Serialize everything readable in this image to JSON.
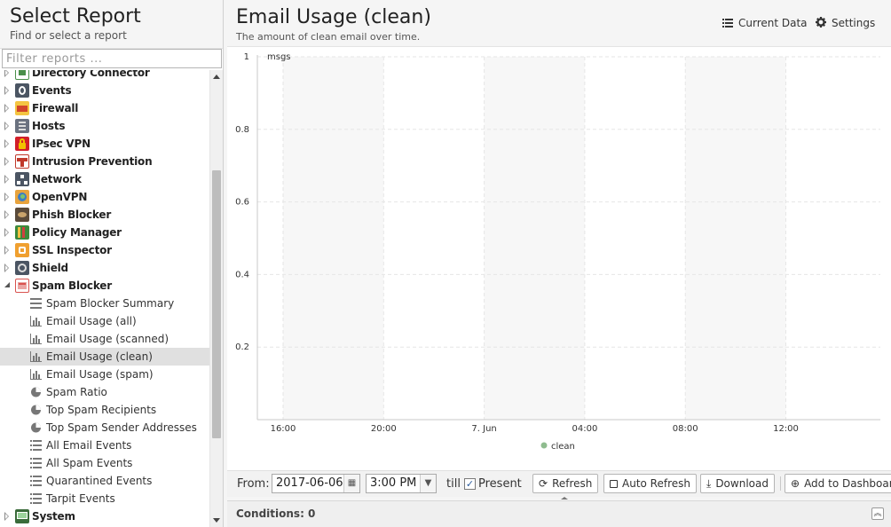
{
  "sidebar": {
    "title": "Select Report",
    "subtitle": "Find or select a report",
    "filter_placeholder": "Filter reports ...",
    "groups": [
      {
        "label": "Directory Connector",
        "icon": "directory-connector-icon",
        "color": "#4a8f4a"
      },
      {
        "label": "Events",
        "icon": "events-icon",
        "color": "#4b5563"
      },
      {
        "label": "Firewall",
        "icon": "firewall-icon",
        "color": "#e0792a"
      },
      {
        "label": "Hosts",
        "icon": "hosts-icon",
        "color": "#6b7280"
      },
      {
        "label": "IPsec VPN",
        "icon": "ipsec-vpn-icon",
        "color": "#d21f2a"
      },
      {
        "label": "Intrusion Prevention",
        "icon": "intrusion-prevention-icon",
        "color": "#c0392b"
      },
      {
        "label": "Network",
        "icon": "network-icon",
        "color": "#4b5563"
      },
      {
        "label": "OpenVPN",
        "icon": "openvpn-icon",
        "color": "#e8a33d"
      },
      {
        "label": "Phish Blocker",
        "icon": "phish-blocker-icon",
        "color": "#5a4a3a"
      },
      {
        "label": "Policy Manager",
        "icon": "policy-manager-icon",
        "color": "#3c8a3c"
      },
      {
        "label": "SSL Inspector",
        "icon": "ssl-inspector-icon",
        "color": "#f0a030"
      },
      {
        "label": "Shield",
        "icon": "shield-icon",
        "color": "#4b5563"
      },
      {
        "label": "Spam Blocker",
        "icon": "spam-blocker-icon",
        "color": "#d9534f"
      }
    ],
    "children": [
      {
        "label": "Spam Blocker Summary",
        "icon": "text-lines-icon"
      },
      {
        "label": "Email Usage (all)",
        "icon": "bar-chart-icon"
      },
      {
        "label": "Email Usage (scanned)",
        "icon": "bar-chart-icon"
      },
      {
        "label": "Email Usage (clean)",
        "icon": "bar-chart-icon",
        "selected": true
      },
      {
        "label": "Email Usage (spam)",
        "icon": "bar-chart-icon"
      },
      {
        "label": "Spam Ratio",
        "icon": "pie-chart-icon"
      },
      {
        "label": "Top Spam Recipients",
        "icon": "pie-chart-icon"
      },
      {
        "label": "Top Spam Sender Addresses",
        "icon": "pie-chart-icon"
      },
      {
        "label": "All Email Events",
        "icon": "list-icon"
      },
      {
        "label": "All Spam Events",
        "icon": "list-icon"
      },
      {
        "label": "Quarantined Events",
        "icon": "list-icon"
      },
      {
        "label": "Tarpit Events",
        "icon": "list-icon"
      }
    ],
    "last_group": {
      "label": "System",
      "icon": "system-icon",
      "color": "#3a6b3a"
    }
  },
  "report": {
    "title": "Email Usage (clean)",
    "description": "The amount of clean email over time.",
    "current_data_label": "Current Data",
    "settings_label": "Settings"
  },
  "chart_data": {
    "type": "line",
    "ylabel": "msgs",
    "ylim": [
      0,
      1
    ],
    "yticks": [
      "1",
      "0.8",
      "0.6",
      "0.4",
      "0.2"
    ],
    "xticks": [
      "16:00",
      "20:00",
      "7. Jun",
      "04:00",
      "08:00",
      "12:00"
    ],
    "series": [
      {
        "name": "clean",
        "values": [],
        "color": "#8fbc8f"
      }
    ],
    "legend": "bottom-center",
    "grid": true
  },
  "toolbar": {
    "from_label": "From:",
    "date_value": "2017-06-06",
    "time_value": "3:00 PM",
    "till_label": "till",
    "present_label": "Present",
    "present_checked": "✓",
    "refresh_label": "Refresh",
    "auto_refresh_label": "Auto Refresh",
    "download_label": "Download",
    "add_dashboard_label": "Add to Dashboard"
  },
  "conditions": {
    "label": "Conditions: 0"
  }
}
